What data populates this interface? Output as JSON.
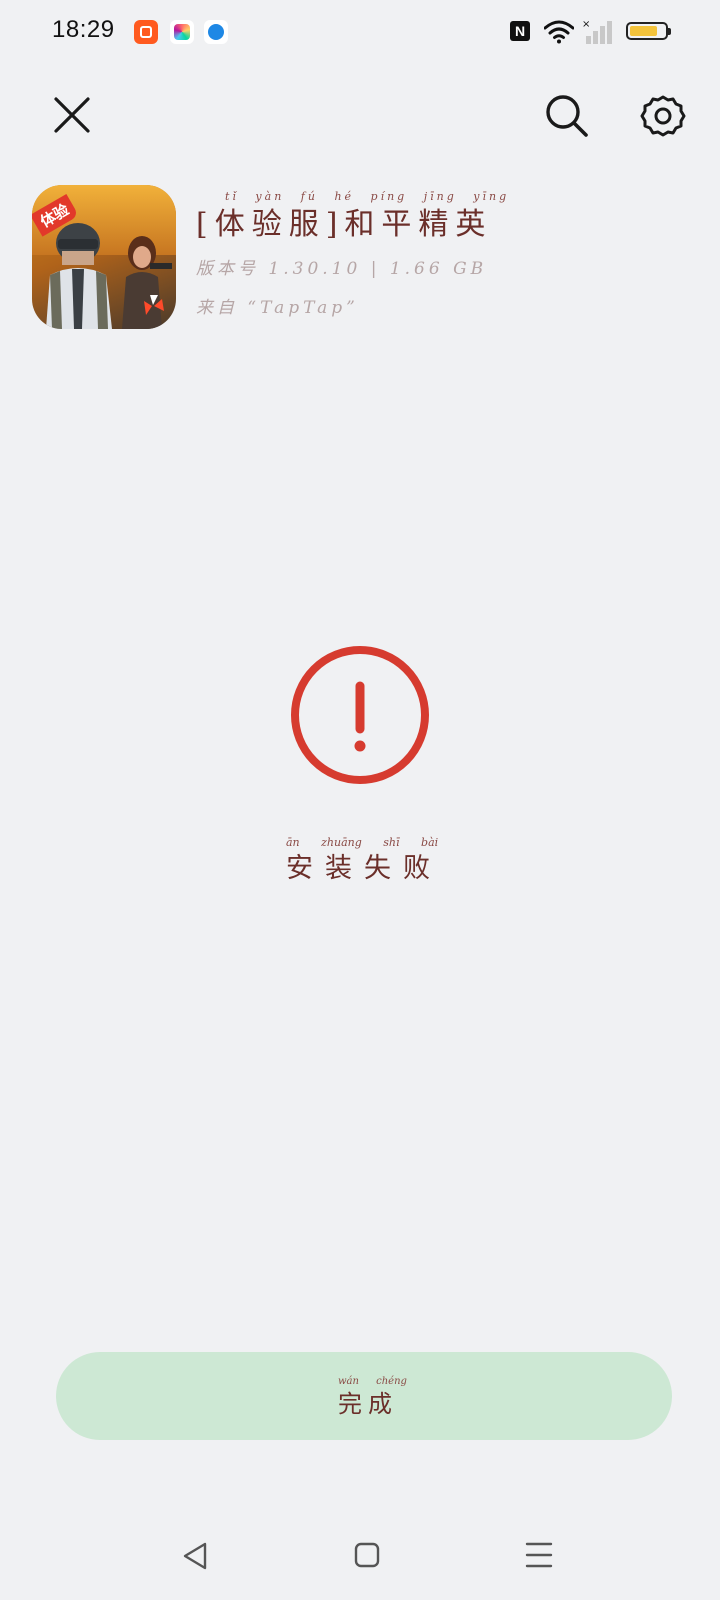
{
  "status_bar": {
    "time": "18:29",
    "notifications": [
      "kuaishou-icon",
      "photos-icon",
      "browser-icon"
    ],
    "nfc": "N",
    "battery_level": 0.8
  },
  "header": {
    "close_icon": "close-icon",
    "search_icon": "search-icon",
    "settings_icon": "gear-icon"
  },
  "app": {
    "title": "[体验服]和平精英",
    "title_pinyin": "tǐ yàn fú hé píng jīng yīng",
    "version": "版本号 1.30.10 | 1.66 GB",
    "source": "来自 “TapTap”",
    "icon_badge": "体验"
  },
  "result": {
    "status_text": "安装失败",
    "status_pinyin": "ān zhuāng shī bài",
    "icon": "exclamation-circle-icon",
    "color": "#d63b2f"
  },
  "actions": {
    "done_label": "完成",
    "done_pinyin": "wán chéng",
    "done_color": "#cde8d4"
  },
  "nav": {
    "back": "back-triangle-icon",
    "home": "home-square-icon",
    "menu": "menu-lines-icon"
  }
}
